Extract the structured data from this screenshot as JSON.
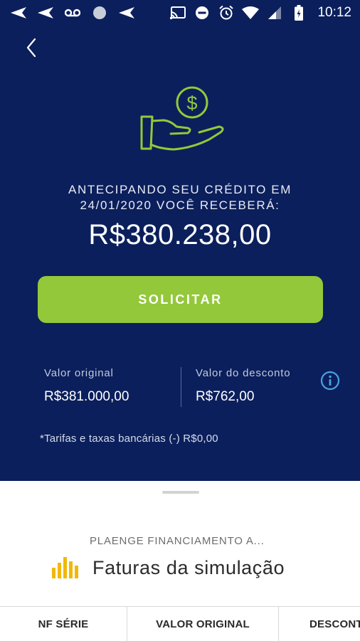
{
  "status_bar": {
    "time": "10:12",
    "left_icons": [
      "send-icon",
      "send-icon",
      "voicemail-icon",
      "circle-icon",
      "send-icon"
    ],
    "right_icons": [
      "cast-icon",
      "do-not-disturb-icon",
      "alarm-icon",
      "wifi-icon",
      "signal-icon",
      "battery-charging-icon"
    ]
  },
  "hero": {
    "message_line1": "ANTECIPANDO SEU CRÉDITO EM",
    "message_line2": "24/01/2020 VOCÊ RECEBERÁ:",
    "amount": "R$380.238,00",
    "cta_label": "SOLICITAR"
  },
  "summary": {
    "original_label": "Valor original",
    "original_value": "R$381.000,00",
    "discount_label": "Valor do desconto",
    "discount_value": "R$762,00"
  },
  "fees_note": "*Tarifas e taxas bancárias (-) R$0,00",
  "sheet": {
    "company": "PLAENGE FINANCIAMENTO A...",
    "title": "Faturas da simulação",
    "columns": [
      "NF SÉRIE",
      "VALOR ORIGINAL",
      "DESCONTO"
    ]
  },
  "colors": {
    "panel_bg": "#0b1f5c",
    "accent_green": "#93c83a",
    "info_blue": "#4aa3df",
    "bars_yellow": "#f2b807"
  }
}
